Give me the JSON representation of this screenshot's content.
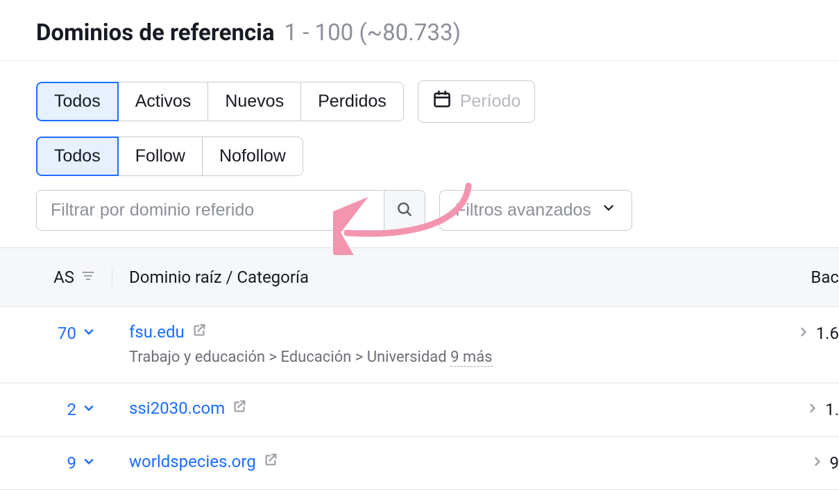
{
  "header": {
    "title": "Dominios de referencia",
    "range_count": "1 - 100 (~80.733)"
  },
  "toolbar": {
    "status_tabs": {
      "all": "Todos",
      "active": "Activos",
      "new": "Nuevos",
      "lost": "Perdidos"
    },
    "period_label": "Período",
    "link_type_tabs": {
      "all": "Todos",
      "follow": "Follow",
      "nofollow": "Nofollow"
    },
    "search_placeholder": "Filtrar por dominio referido",
    "advanced_filters": "Filtros avanzados"
  },
  "table": {
    "columns": {
      "as": "AS",
      "domain_category": "Dominio raíz / Categoría",
      "backlinks": "Bac"
    },
    "rows": [
      {
        "as": "70",
        "domain": "fsu.edu",
        "category_path": "Trabajo y educación > Educación > Universidad",
        "category_more": "9 más",
        "backlinks_display": "1.6"
      },
      {
        "as": "2",
        "domain": "ssi2030.com",
        "category_path": "",
        "category_more": "",
        "backlinks_display": "1."
      },
      {
        "as": "9",
        "domain": "worldspecies.org",
        "category_path": "",
        "category_more": "",
        "backlinks_display": "9"
      }
    ]
  },
  "colors": {
    "link": "#1a6dff",
    "muted": "#8c8f98",
    "border": "#c6cace",
    "annotation": "#f495b0"
  }
}
